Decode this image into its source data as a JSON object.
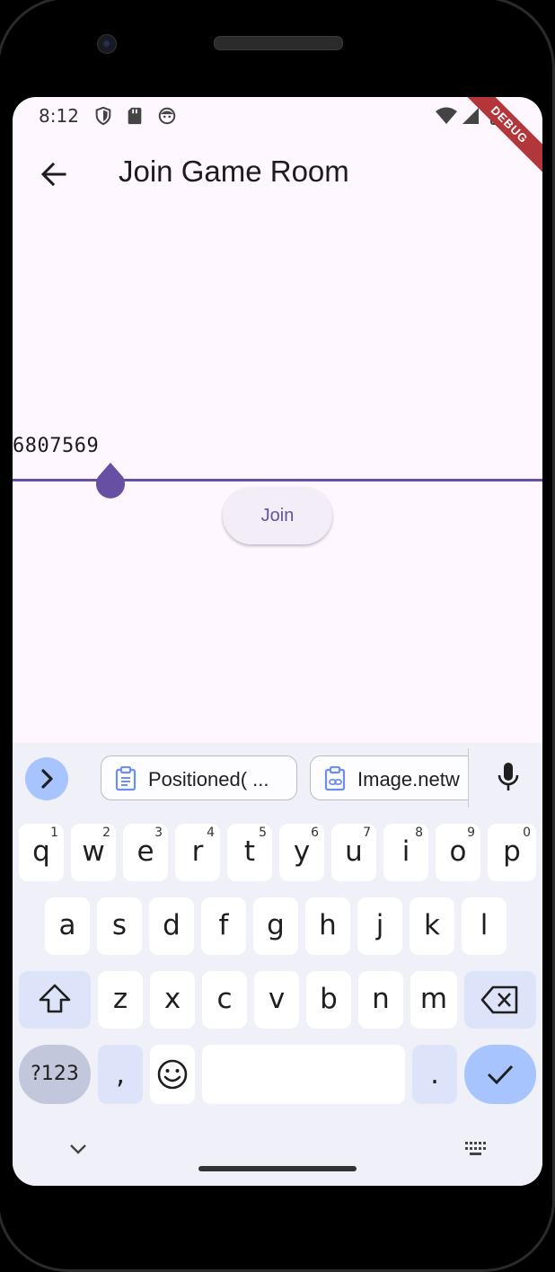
{
  "status_bar": {
    "time": "8:12",
    "debug_banner": "DEBUG"
  },
  "app_bar": {
    "title": "Join Game Room"
  },
  "room_field": {
    "value": "6807569"
  },
  "join_button": {
    "label": "Join"
  },
  "keyboard": {
    "suggestions": [
      {
        "label": "Positioned( ..."
      },
      {
        "label": "Image.netw"
      }
    ],
    "row1": [
      {
        "key": "q",
        "hint": "1"
      },
      {
        "key": "w",
        "hint": "2"
      },
      {
        "key": "e",
        "hint": "3"
      },
      {
        "key": "r",
        "hint": "4"
      },
      {
        "key": "t",
        "hint": "5"
      },
      {
        "key": "y",
        "hint": "6"
      },
      {
        "key": "u",
        "hint": "7"
      },
      {
        "key": "i",
        "hint": "8"
      },
      {
        "key": "o",
        "hint": "9"
      },
      {
        "key": "p",
        "hint": "0"
      }
    ],
    "row2": [
      "a",
      "s",
      "d",
      "f",
      "g",
      "h",
      "j",
      "k",
      "l"
    ],
    "row3": [
      "z",
      "x",
      "c",
      "v",
      "b",
      "n",
      "m"
    ],
    "symbols_label": "?123",
    "comma_label": ",",
    "period_label": ".",
    "colors": {
      "key": "#ffffff",
      "modifier": "#dde3f8",
      "accent": "#a8c4ff",
      "background": "#f0f0f8"
    }
  },
  "colors": {
    "primary": "#6750a4",
    "surface": "#fef7ff"
  }
}
